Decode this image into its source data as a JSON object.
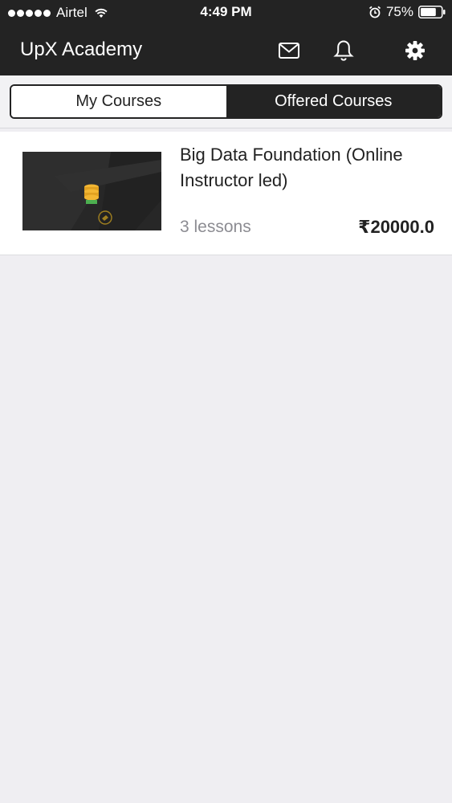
{
  "status_bar": {
    "carrier": "Airtel",
    "time": "4:49 PM",
    "battery": "75%",
    "battery_level": 0.75,
    "icons": [
      "signal-dots-icon",
      "wifi-icon",
      "alarm-icon",
      "battery-icon"
    ]
  },
  "header": {
    "title": "UpX Academy",
    "icons": [
      "mail-icon",
      "bell-icon",
      "gear-icon"
    ]
  },
  "tabs": [
    {
      "label": "My Courses",
      "active": true
    },
    {
      "label": "Offered Courses",
      "active": false
    }
  ],
  "courses": [
    {
      "title": "Big Data Foundation (Online Instructor led)",
      "lessons": "3 lessons",
      "price": "₹20000.0",
      "thumbnail_icon": "database-icon"
    }
  ],
  "colors": {
    "header_bg": "#232323",
    "page_bg": "#efeef2",
    "accent": "#f2b632"
  }
}
